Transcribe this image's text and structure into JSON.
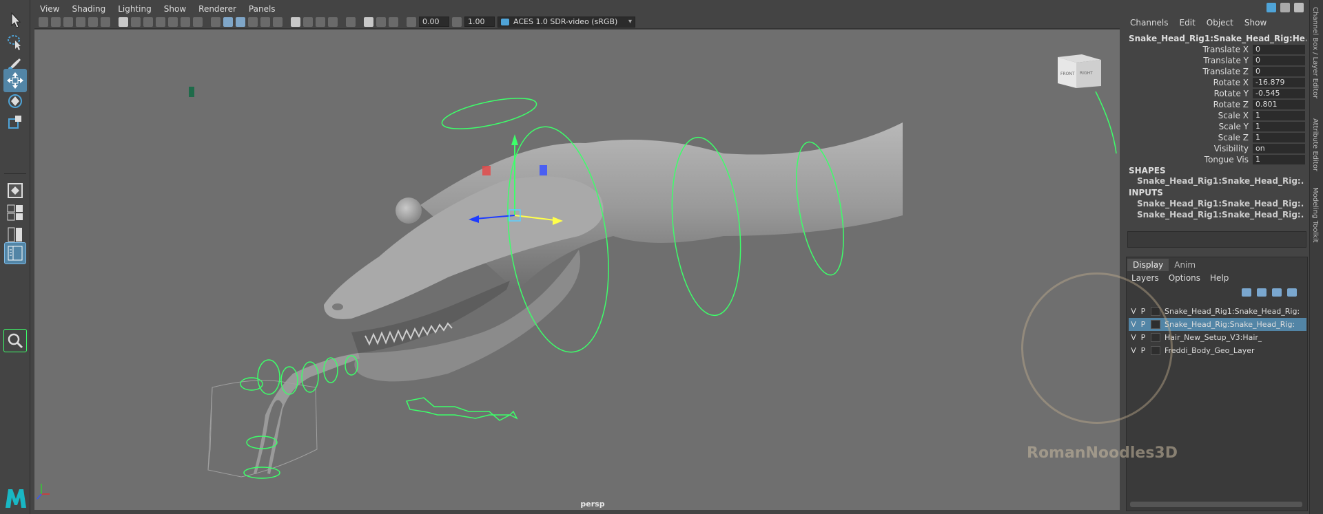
{
  "viewport": {
    "menu": [
      "View",
      "Shading",
      "Lighting",
      "Show",
      "Renderer",
      "Panels"
    ],
    "toolbar": {
      "exposure": "0.00",
      "gamma": "1.00",
      "color_space": "ACES 1.0 SDR-video (sRGB)"
    },
    "camera_name": "persp",
    "view_cube": {
      "front": "FRONT",
      "right": "RIGHT"
    }
  },
  "channel_box": {
    "menu": [
      "Channels",
      "Edit",
      "Object",
      "Show"
    ],
    "object_name": "Snake_Head_Rig1:Snake_Head_Rig:He...",
    "attributes": [
      {
        "label": "Translate X",
        "value": "0"
      },
      {
        "label": "Translate Y",
        "value": "0"
      },
      {
        "label": "Translate Z",
        "value": "0"
      },
      {
        "label": "Rotate X",
        "value": "-16.879"
      },
      {
        "label": "Rotate Y",
        "value": "-0.545"
      },
      {
        "label": "Rotate Z",
        "value": "0.801"
      },
      {
        "label": "Scale X",
        "value": "1"
      },
      {
        "label": "Scale Y",
        "value": "1"
      },
      {
        "label": "Scale Z",
        "value": "1"
      },
      {
        "label": "Visibility",
        "value": "on"
      },
      {
        "label": "Tongue Vis",
        "value": "1"
      }
    ],
    "shapes_header": "SHAPES",
    "shapes": [
      "Snake_Head_Rig1:Snake_Head_Rig:..."
    ],
    "inputs_header": "INPUTS",
    "inputs": [
      "Snake_Head_Rig1:Snake_Head_Rig:...",
      "Snake_Head_Rig1:Snake_Head_Rig:..."
    ]
  },
  "layer_editor": {
    "tabs": [
      "Display",
      "Anim"
    ],
    "menu": [
      "Layers",
      "Options",
      "Help"
    ],
    "layers": [
      {
        "v": "V",
        "p": "P",
        "name": "Snake_Head_Rig1:Snake_Head_Rig:",
        "selected": false
      },
      {
        "v": "V",
        "p": "P",
        "name": "Snake_Head_Rig:Snake_Head_Rig:",
        "selected": true
      },
      {
        "v": "V",
        "p": "P",
        "name": "Hair_New_Setup_V3:Hair_",
        "selected": false
      },
      {
        "v": "V",
        "p": "P",
        "name": "Freddi_Body_Geo_Layer",
        "selected": false
      }
    ]
  },
  "side_tabs": [
    "Channel Box / Layer Editor",
    "Attribute Editor",
    "Modeling Toolkit"
  ],
  "watermark": "RomanNoodles3D",
  "colors": {
    "accent": "#5285a6",
    "controls": "#3dff6a",
    "viewport_bg": "#6f6f6f"
  }
}
